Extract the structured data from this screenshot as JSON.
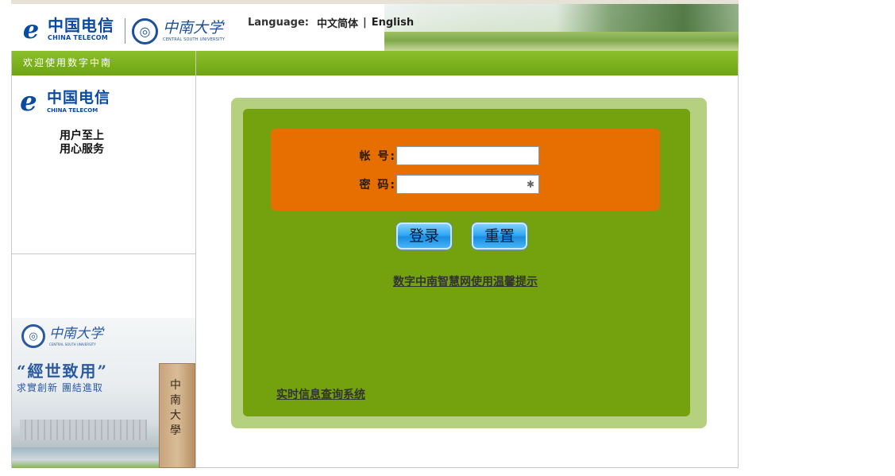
{
  "header": {
    "telecom_logo_cn": "中国电信",
    "telecom_logo_en": "CHINA TELECOM",
    "csu_logo_cn": "中南大学",
    "csu_logo_en": "CENTRAL SOUTH UNIVERSITY",
    "language_label": "Language:",
    "lang_options": [
      "中文简体",
      "English"
    ],
    "lang_separator": "|"
  },
  "sidebar": {
    "title": "欢迎使用数字中南",
    "logo_cn": "中国电信",
    "logo_en": "CHINA TELECOM",
    "slogan_line1": "用户至上",
    "slogan_line2": "用心服务",
    "banner": {
      "csu_cn": "中南大学",
      "csu_en": "CENTRAL SOUTH UNIVERSITY",
      "motto": "“經世致用”",
      "submotto": "求實創新 團結進取",
      "gate_text": "中南大學"
    }
  },
  "login": {
    "account_label": "帐 号:",
    "account_value": "",
    "password_label": "密 码:",
    "password_value": "",
    "login_button": "登录",
    "reset_button": "重置",
    "tips_link": "数字中南智慧网使用温馨提示",
    "realtime_link": "实时信息查询系统"
  },
  "colors": {
    "green_header": "#7ab21e",
    "panel_outer": "#b5d17f",
    "panel_inner": "#74a10e",
    "login_box": "#e76e00",
    "button_blue": "#33a8f3",
    "telecom_blue": "#0a4aa0"
  },
  "icons": {
    "telecom_logo": "telecom-logo-icon",
    "csu_seal": "csu-seal-icon",
    "password_key": "key-icon"
  }
}
